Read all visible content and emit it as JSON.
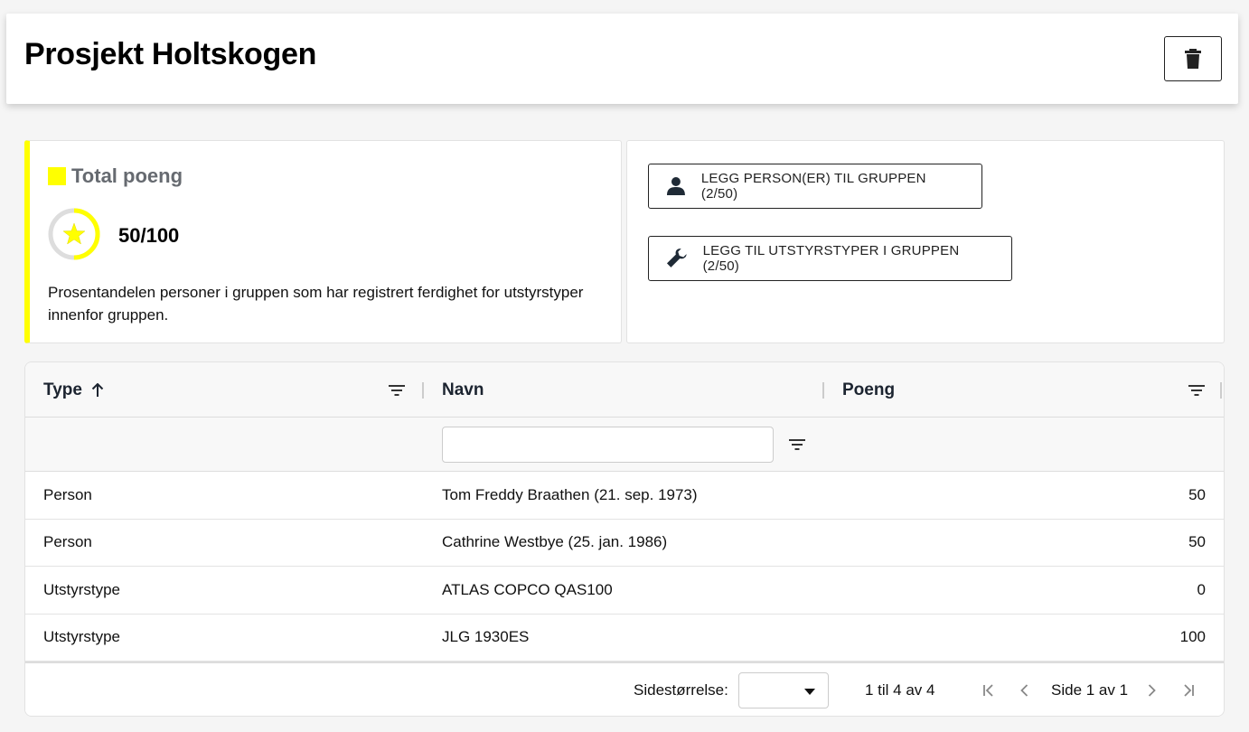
{
  "header": {
    "title": "Prosjekt Holtskogen"
  },
  "colors": {
    "accent": "#ffff00",
    "border": "#222222"
  },
  "score": {
    "title": "Total poeng",
    "value": "50/100",
    "progress_fraction": 0.5,
    "description": "Prosentandelen personer i gruppen som har registrert ferdighet for utstyrstyper innenfor gruppen."
  },
  "actions": {
    "add_person_label": "LEGG PERSON(ER) TIL GRUPPEN (2/50)",
    "add_equipment_label": "LEGG TIL UTSTYRSTYPER I GRUPPEN (2/50)"
  },
  "table": {
    "columns": {
      "type": "Type",
      "navn": "Navn",
      "poeng": "Poeng"
    },
    "sort": {
      "column": "Type",
      "direction": "ascending"
    },
    "filter": {
      "navn_value": ""
    },
    "rows": [
      {
        "type": "Person",
        "navn": "Tom Freddy Braathen (21. sep. 1973)",
        "poeng": "50"
      },
      {
        "type": "Person",
        "navn": "Cathrine Westbye (25. jan. 1986)",
        "poeng": "50"
      },
      {
        "type": "Utstyrstype",
        "navn": "ATLAS COPCO QAS100",
        "poeng": "0"
      },
      {
        "type": "Utstyrstype",
        "navn": "JLG 1930ES",
        "poeng": "100"
      }
    ]
  },
  "pagination": {
    "page_size_label": "Sidestørrelse:",
    "page_size_value": "",
    "range_text": "1 til 4 av 4",
    "page_text": "Side 1 av 1"
  },
  "icons": {
    "delete": "trash-icon",
    "person": "person-icon",
    "equipment": "wrench-icon",
    "sort": "arrow-up-icon",
    "filter": "filter-icon",
    "first": "first-page-icon",
    "prev": "chevron-left-icon",
    "next": "chevron-right-icon",
    "last": "last-page-icon"
  }
}
